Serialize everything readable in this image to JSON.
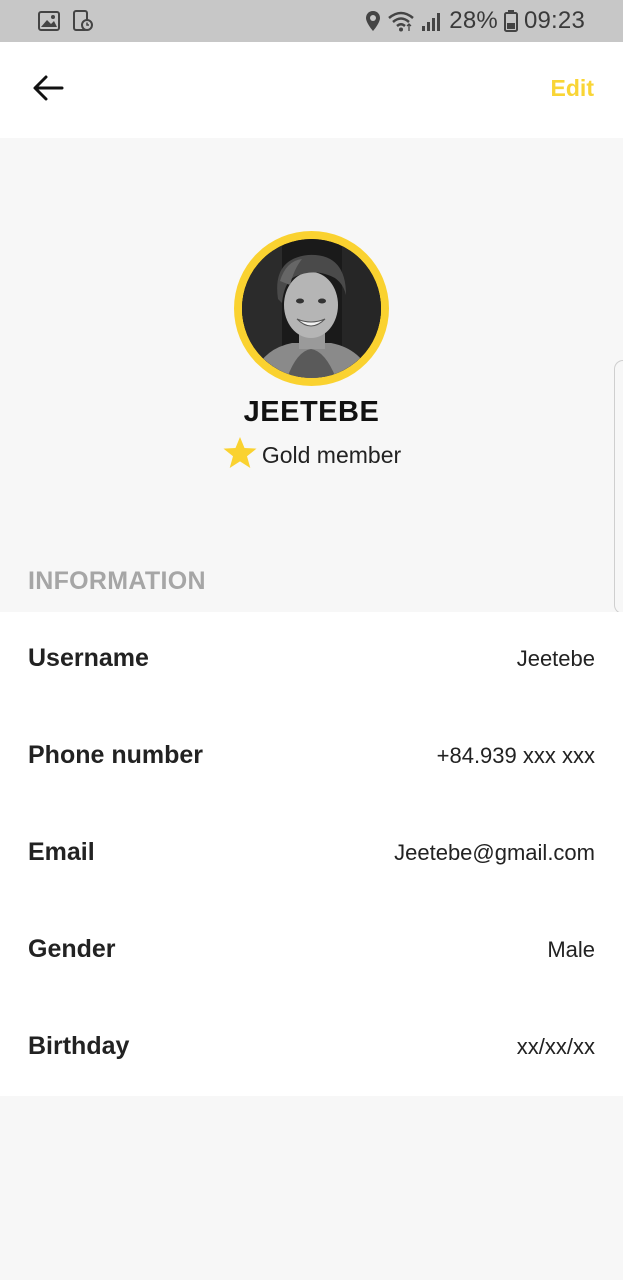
{
  "status_bar": {
    "battery_percent": "28%",
    "time": "09:23",
    "icons": [
      "gallery-icon",
      "screenshot-icon",
      "location-icon",
      "wifi-icon",
      "signal-icon",
      "battery-icon"
    ]
  },
  "app_bar": {
    "back_icon": "arrow-left-icon",
    "edit_label": "Edit"
  },
  "profile": {
    "name": "JEETEBE",
    "membership": "Gold member",
    "membership_icon": "star-icon",
    "avatar_ring_color": "#fad230"
  },
  "information": {
    "section_title": "INFORMATION",
    "rows": [
      {
        "label": "Username",
        "value": "Jeetebe"
      },
      {
        "label": "Phone number",
        "value": "+84.939 xxx xxx"
      },
      {
        "label": "Email",
        "value": "Jeetebe@gmail.com"
      },
      {
        "label": "Gender",
        "value": "Male"
      },
      {
        "label": "Birthday",
        "value": "xx/xx/xx"
      }
    ]
  },
  "colors": {
    "accent": "#f9d535",
    "status_bar_bg": "#c7c7c7",
    "page_bg": "#f7f7f7",
    "card_bg": "#ffffff",
    "section_header": "#a6a6a6"
  }
}
